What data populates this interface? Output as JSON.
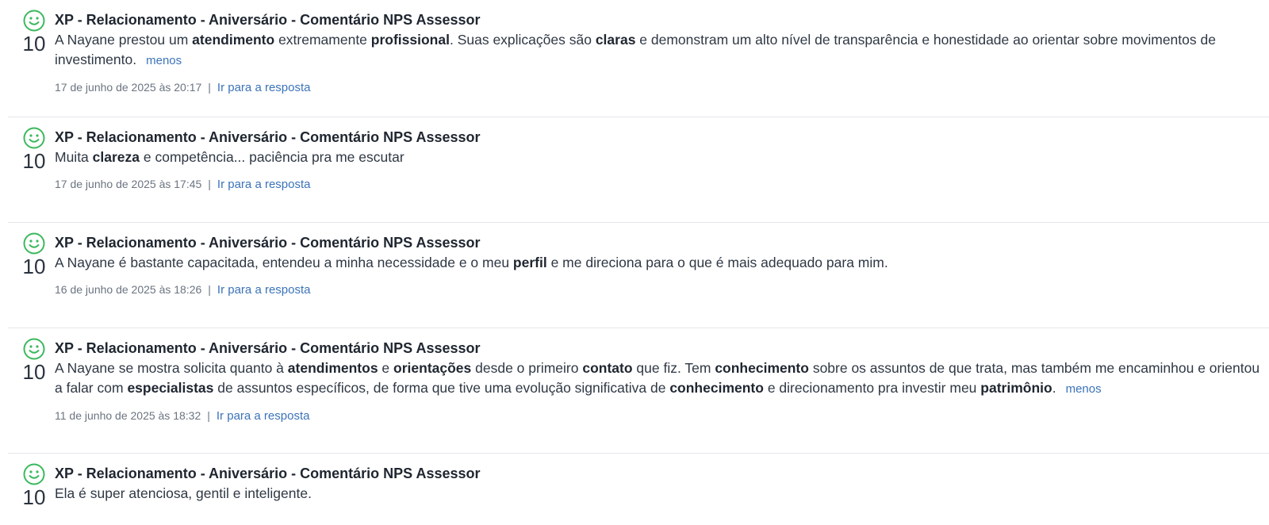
{
  "items": [
    {
      "score": "10",
      "title": "XP - Relacionamento - Aniversário - Comentário NPS Assessor",
      "comment": [
        {
          "t": "A Nayane prestou um "
        },
        {
          "t": "atendimento",
          "b": true
        },
        {
          "t": " extremamente "
        },
        {
          "t": "profissional",
          "b": true
        },
        {
          "t": ". Suas explicações são "
        },
        {
          "t": "claras",
          "b": true
        },
        {
          "t": " e demonstram um alto nível de transparência e honestidade ao orientar sobre movimentos de investimento."
        }
      ],
      "less_label": "menos",
      "date": "17 de junho de 2025 às 20:17",
      "separator": "|",
      "link_label": "Ir para a resposta"
    },
    {
      "score": "10",
      "title": "XP - Relacionamento - Aniversário - Comentário NPS Assessor",
      "comment": [
        {
          "t": "Muita "
        },
        {
          "t": "clareza",
          "b": true
        },
        {
          "t": " e competência... paciência pra me escutar"
        }
      ],
      "less_label": "",
      "date": "17 de junho de 2025 às 17:45",
      "separator": "|",
      "link_label": "Ir para a resposta"
    },
    {
      "score": "10",
      "title": "XP - Relacionamento - Aniversário - Comentário NPS Assessor",
      "comment": [
        {
          "t": "A Nayane é bastante capacitada, entendeu a minha necessidade e o meu "
        },
        {
          "t": "perfil",
          "b": true
        },
        {
          "t": " e me direciona para o que é mais adequado para mim."
        }
      ],
      "less_label": "",
      "date": "16 de junho de 2025 às 18:26",
      "separator": "|",
      "link_label": "Ir para a resposta"
    },
    {
      "score": "10",
      "title": "XP - Relacionamento - Aniversário - Comentário NPS Assessor",
      "comment": [
        {
          "t": "A Nayane se mostra solicita quanto à "
        },
        {
          "t": "atendimentos",
          "b": true
        },
        {
          "t": " e "
        },
        {
          "t": "orientações",
          "b": true
        },
        {
          "t": " desde o primeiro "
        },
        {
          "t": "contato",
          "b": true
        },
        {
          "t": " que fiz. Tem "
        },
        {
          "t": "conhecimento",
          "b": true
        },
        {
          "t": " sobre os assuntos de que trata, mas também me encaminhou e orientou a falar com "
        },
        {
          "t": "especialistas",
          "b": true
        },
        {
          "t": " de assuntos específicos, de forma que tive uma evolução significativa de "
        },
        {
          "t": "conhecimento",
          "b": true
        },
        {
          "t": " e direcionamento pra investir meu "
        },
        {
          "t": "patrimônio",
          "b": true
        },
        {
          "t": "."
        }
      ],
      "less_label": "menos",
      "date": "11 de junho de 2025 às 18:32",
      "separator": "|",
      "link_label": "Ir para a resposta"
    },
    {
      "score": "10",
      "title": "XP - Relacionamento - Aniversário - Comentário NPS Assessor",
      "comment": [
        {
          "t": "Ela é super atenciosa, gentil e inteligente."
        }
      ],
      "less_label": "",
      "date": "",
      "separator": "",
      "link_label": ""
    }
  ],
  "icons": {
    "score_icon": "smiley-icon"
  },
  "colors": {
    "smiley_green": "#3cb85e",
    "link_blue": "#3b73b9",
    "divider": "#e3e6ea"
  }
}
